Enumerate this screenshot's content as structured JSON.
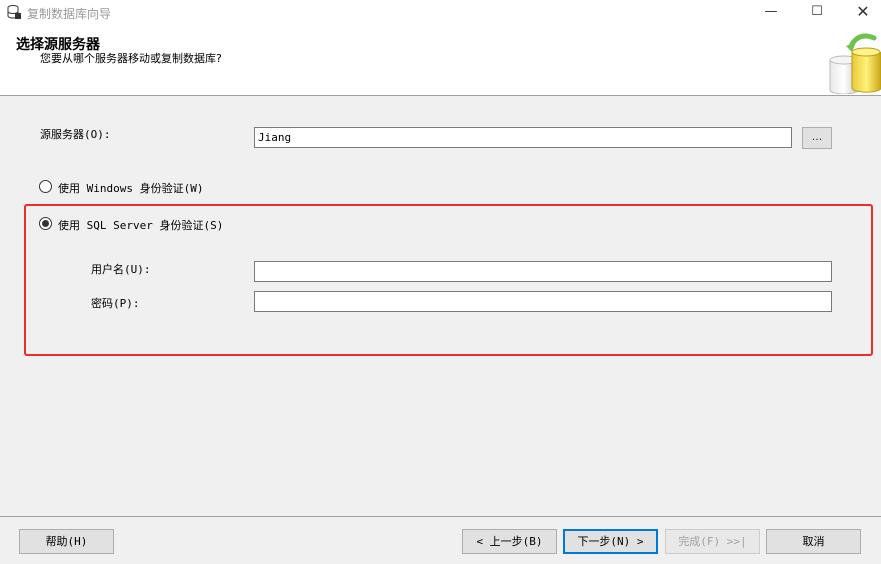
{
  "window": {
    "title": "复制数据库向导",
    "min_glyph": "—",
    "max_glyph": "☐",
    "close_glyph": "✕"
  },
  "header": {
    "title": "选择源服务器",
    "subtitle": "您要从哪个服务器移动或复制数据库?"
  },
  "form": {
    "source_server_label": "源服务器(O):",
    "source_server_value": "Jiang",
    "browse_label": "...",
    "auth_windows_label": "使用 Windows 身份验证(W)",
    "auth_sql_label": "使用 SQL Server 身份验证(S)",
    "auth_selected": "sql",
    "username_label": "用户名(U):",
    "username_value": "",
    "password_label": "密码(P):",
    "password_value": ""
  },
  "footer": {
    "help": "帮助(H)",
    "back": "< 上一步(B)",
    "next": "下一步(N) >",
    "finish": "完成(F) >>|",
    "cancel": "取消"
  },
  "colors": {
    "highlight_border": "#e5302a",
    "accent": "#0078d7"
  }
}
